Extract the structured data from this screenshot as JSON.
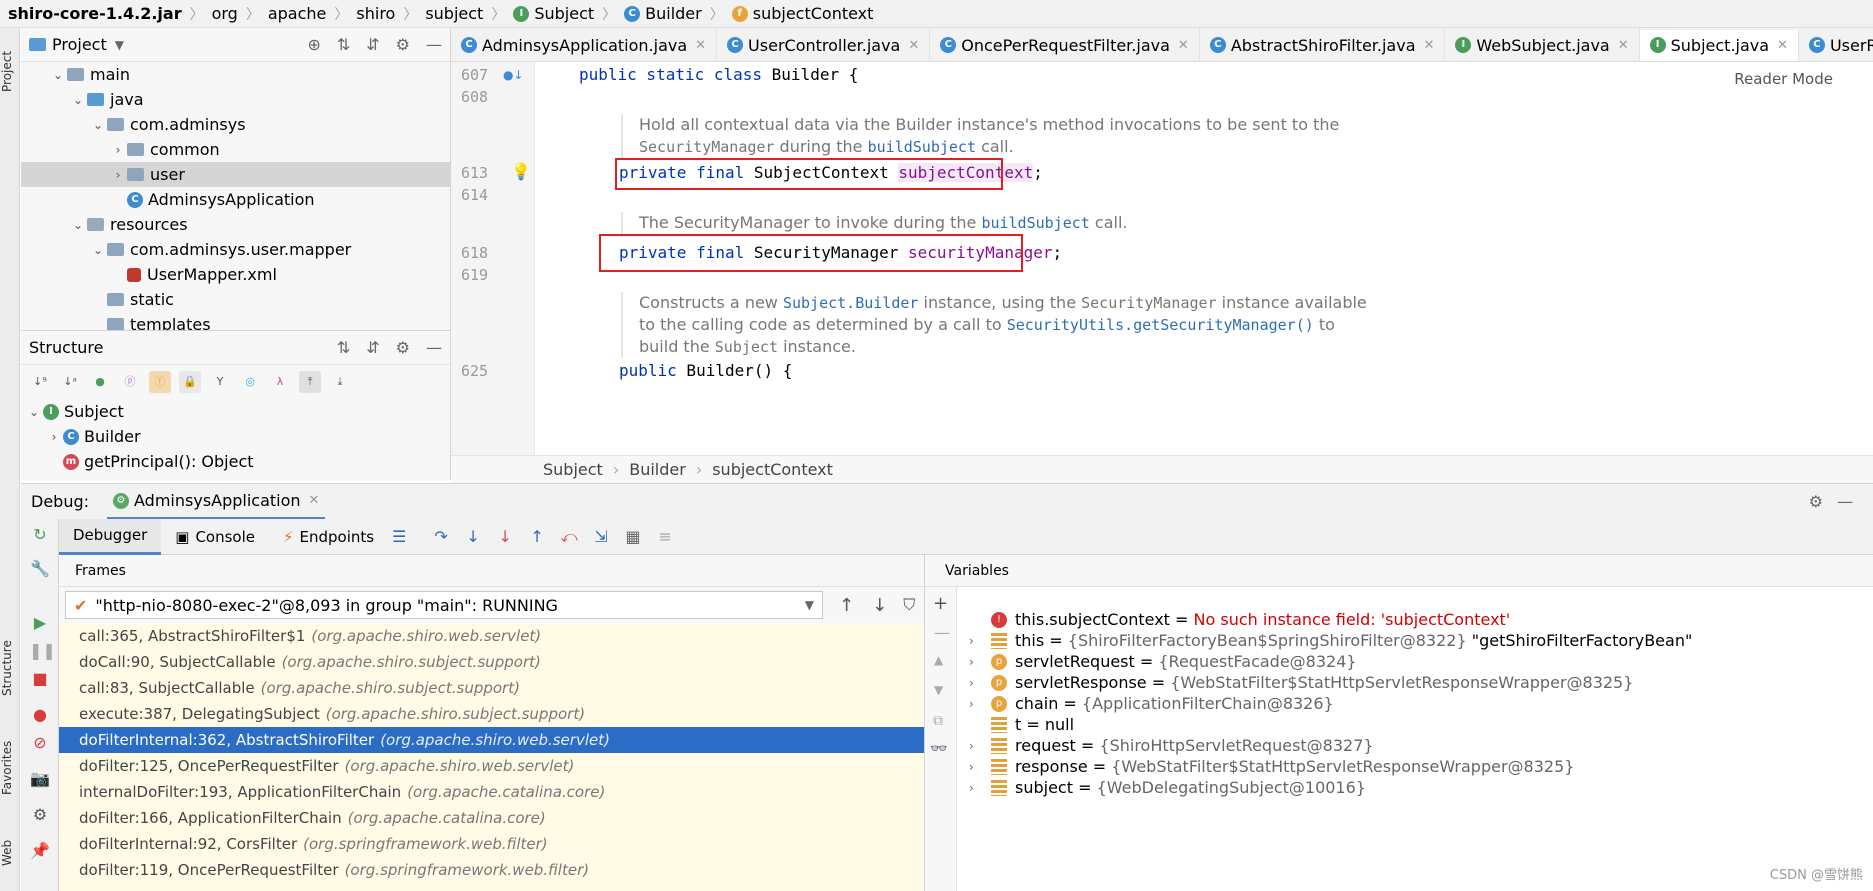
{
  "breadcrumb": [
    "shiro-core-1.4.2.jar",
    "org",
    "apache",
    "shiro",
    "subject",
    "Subject",
    "Builder",
    "subjectContext"
  ],
  "left_stripe": {
    "project": "Project",
    "structure": "Structure",
    "favorites": "Favorites",
    "web": "Web"
  },
  "project_panel": {
    "title": "Project",
    "tree": [
      {
        "label": "main",
        "indent": 1,
        "arrow": "open"
      },
      {
        "label": "java",
        "indent": 2,
        "arrow": "open"
      },
      {
        "label": "com.adminsys",
        "indent": 3,
        "arrow": "open"
      },
      {
        "label": "common",
        "indent": 4,
        "arrow": "closed"
      },
      {
        "label": "user",
        "indent": 4,
        "arrow": "closed",
        "selected": true
      },
      {
        "label": "AdminsysApplication",
        "indent": 4,
        "arrow": "none"
      },
      {
        "label": "resources",
        "indent": 2,
        "arrow": "open"
      },
      {
        "label": "com.adminsys.user.mapper",
        "indent": 3,
        "arrow": "open"
      },
      {
        "label": "UserMapper.xml",
        "indent": 4,
        "arrow": "none"
      },
      {
        "label": "static",
        "indent": 3,
        "arrow": "none"
      },
      {
        "label": "templates",
        "indent": 3,
        "arrow": "none"
      }
    ]
  },
  "structure_panel": {
    "title": "Structure",
    "items": [
      {
        "label": "Subject",
        "icon": "I"
      },
      {
        "label": "Builder",
        "icon": "C"
      },
      {
        "label": "getPrincipal(): Object",
        "icon": "m"
      }
    ]
  },
  "editor_tabs": [
    {
      "label": "AdminsysApplication.java",
      "icon": "C"
    },
    {
      "label": "UserController.java",
      "icon": "C"
    },
    {
      "label": "OncePerRequestFilter.java",
      "icon": "C"
    },
    {
      "label": "AbstractShiroFilter.java",
      "icon": "C"
    },
    {
      "label": "WebSubject.java",
      "icon": "I"
    },
    {
      "label": "Subject.java",
      "icon": "I",
      "active": true
    },
    {
      "label": "UserRealm.ja",
      "icon": "C"
    }
  ],
  "editor": {
    "reader_mode": "Reader Mode",
    "line_numbers": [
      "607",
      "608",
      "613",
      "614",
      "618",
      "619",
      "625"
    ],
    "line_607": {
      "kw": "public static class",
      "rest": " Builder {"
    },
    "doc1": {
      "t1": "Hold all contextual data via the Builder instance's method invocations to be sent to the",
      "c1": "SecurityManager",
      "t2": " during the ",
      "l1": "buildSubject",
      "t3": " call."
    },
    "line_613": {
      "kw": "private final",
      "type": " SubjectContext ",
      "field": "subjectContext",
      "end": ";"
    },
    "doc2": {
      "t1": "The SecurityManager to invoke during the ",
      "l1": "buildSubject",
      "t2": " call."
    },
    "line_618": {
      "kw": "private final",
      "type": " SecurityManager ",
      "field": "securityManager",
      "end": ";"
    },
    "doc3": {
      "t1": "Constructs a new ",
      "l1": "Subject.Builder",
      "t2": " instance, using the ",
      "c1": "SecurityManager",
      "t3": " instance available",
      "t4": "to the calling code as determined by a call to ",
      "l2": "SecurityUtils.getSecurityManager()",
      "t5": " to",
      "t6": "build the ",
      "c2": "Subject",
      "t7": " instance."
    },
    "line_625": {
      "kw": "public",
      "rest": " Builder() {"
    }
  },
  "code_crumb": [
    "Subject",
    "Builder",
    "subjectContext"
  ],
  "debug": {
    "label": "Debug:",
    "config": "AdminsysApplication",
    "tabs": [
      "Debugger",
      "Console",
      "Endpoints"
    ],
    "frames_title": "Frames",
    "variables_title": "Variables",
    "thread": "\"http-nio-8080-exec-2\"@8,093 in group \"main\": RUNNING",
    "frames": [
      {
        "method": "call:365, AbstractShiroFilter$1",
        "pkg": "(org.apache.shiro.web.servlet)"
      },
      {
        "method": "doCall:90, SubjectCallable",
        "pkg": "(org.apache.shiro.subject.support)"
      },
      {
        "method": "call:83, SubjectCallable",
        "pkg": "(org.apache.shiro.subject.support)"
      },
      {
        "method": "execute:387, DelegatingSubject",
        "pkg": "(org.apache.shiro.subject.support)"
      },
      {
        "method": "doFilterInternal:362, AbstractShiroFilter",
        "pkg": "(org.apache.shiro.web.servlet)",
        "selected": true
      },
      {
        "method": "doFilter:125, OncePerRequestFilter",
        "pkg": "(org.apache.shiro.web.servlet)"
      },
      {
        "method": "internalDoFilter:193, ApplicationFilterChain",
        "pkg": "(org.apache.catalina.core)"
      },
      {
        "method": "doFilter:166, ApplicationFilterChain",
        "pkg": "(org.apache.catalina.core)"
      },
      {
        "method": "doFilterInternal:92, CorsFilter",
        "pkg": "(org.springframework.web.filter)"
      },
      {
        "method": "doFilter:119, OncePerRequestFilter",
        "pkg": "(org.springframework.web.filter)"
      }
    ],
    "variables": [
      {
        "name": "this.subjectContext",
        "eq": " = ",
        "value": "No such instance field: 'subjectContext'",
        "kind": "error",
        "expand": false
      },
      {
        "name": "this",
        "eq": " = ",
        "value": "{ShiroFilterFactoryBean$SpringShiroFilter@8322}",
        "extra": " \"getShiroFilterFactoryBean\"",
        "kind": "eq",
        "expand": true
      },
      {
        "name": "servletRequest",
        "eq": " = ",
        "value": "{RequestFacade@8324}",
        "kind": "p",
        "expand": true
      },
      {
        "name": "servletResponse",
        "eq": " = ",
        "value": "{WebStatFilter$StatHttpServletResponseWrapper@8325}",
        "kind": "p",
        "expand": true
      },
      {
        "name": "chain",
        "eq": " = ",
        "value": "{ApplicationFilterChain@8326}",
        "kind": "p",
        "expand": true
      },
      {
        "name": "t",
        "eq": " = ",
        "value": "null",
        "kind": "eq",
        "expand": false
      },
      {
        "name": "request",
        "eq": " = ",
        "value": "{ShiroHttpServletRequest@8327}",
        "kind": "eq",
        "expand": true
      },
      {
        "name": "response",
        "eq": " = ",
        "value": "{WebStatFilter$StatHttpServletResponseWrapper@8325}",
        "kind": "eq",
        "expand": true
      },
      {
        "name": "subject",
        "eq": " = ",
        "value": "{WebDelegatingSubject@10016}",
        "kind": "eq",
        "expand": true
      }
    ]
  },
  "watermark": "CSDN @雪饼熊",
  "colors": {
    "selection": "#2b6cc4",
    "highlight_box": "#e02020",
    "keyword": "#0033b3",
    "field": "#871094"
  }
}
